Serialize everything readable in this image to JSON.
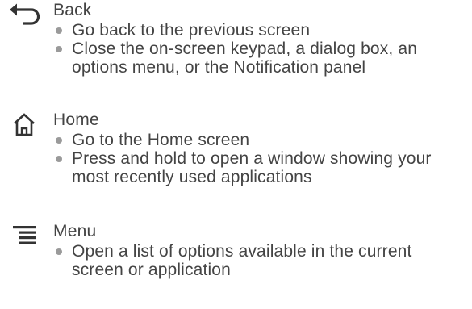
{
  "entries": [
    {
      "icon": "back-arrow-icon",
      "title": "Back",
      "bullets": [
        "Go back to the previous screen",
        "Close the on-screen keypad, a dialog box, an options menu, or the Notification panel"
      ]
    },
    {
      "icon": "home-icon",
      "title": "Home",
      "bullets": [
        "Go to the Home screen",
        "Press and hold to open a window showing your most recently used applications"
      ]
    },
    {
      "icon": "menu-icon",
      "title": "Menu",
      "bullets": [
        "Open a list of options available in the current screen or application"
      ]
    }
  ],
  "colors": {
    "text": "#444444",
    "icon": "#333333",
    "bullet": "#9a9a9a"
  }
}
